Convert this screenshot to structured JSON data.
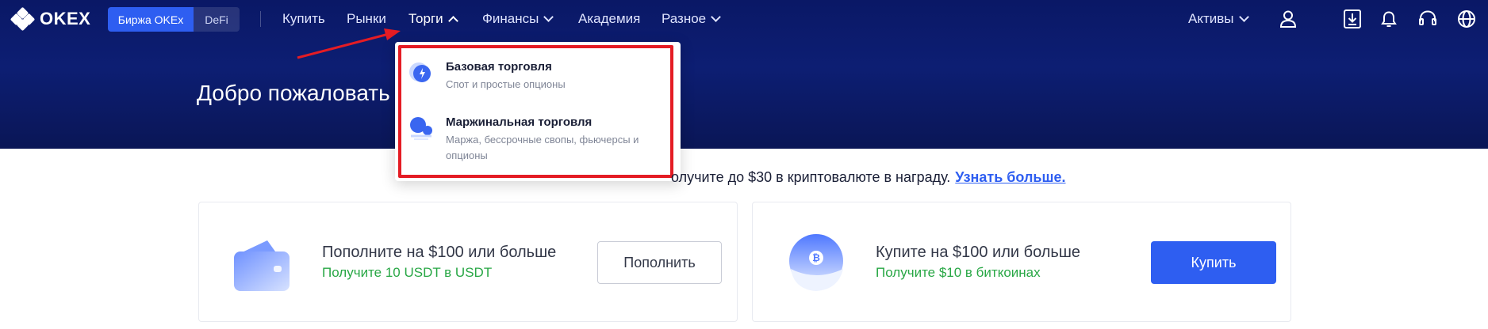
{
  "brand": {
    "name": "OKEX"
  },
  "header": {
    "switch": {
      "exchange": "Биржа OKEx",
      "defi": "DeFi"
    },
    "nav": [
      "Купить",
      "Рынки",
      "Торги",
      "Финансы",
      "Академия",
      "Разное"
    ],
    "assets": "Активы",
    "icons": [
      "user-icon",
      "download-icon",
      "bell-icon",
      "headset-icon",
      "globe-icon"
    ]
  },
  "hero": {
    "welcome": "Добро пожаловать в"
  },
  "dropdown": {
    "items": [
      {
        "title": "Базовая торговля",
        "subtitle": "Спот и простые опционы"
      },
      {
        "title": "Маржинальная торговля",
        "subtitle_line1": "Маржа, бессрочные свопы, фьючерсы и",
        "subtitle_line2": "опционы"
      }
    ]
  },
  "promo": {
    "text": "олучите до $30 в криптовалюте в награду.",
    "link": "Узнать больше."
  },
  "cards": [
    {
      "title": "Пополните на $100 или больше",
      "subtitle": "Получите 10 USDT в USDT",
      "button": "Пополнить"
    },
    {
      "title": "Купите на $100 или больше",
      "subtitle": "Получите $10 в биткоинах",
      "button": "Купить"
    }
  ],
  "colors": {
    "accent": "#2e5ef1",
    "header_bg": "#0d1e73",
    "highlight": "#e41c24",
    "success": "#28a745"
  }
}
